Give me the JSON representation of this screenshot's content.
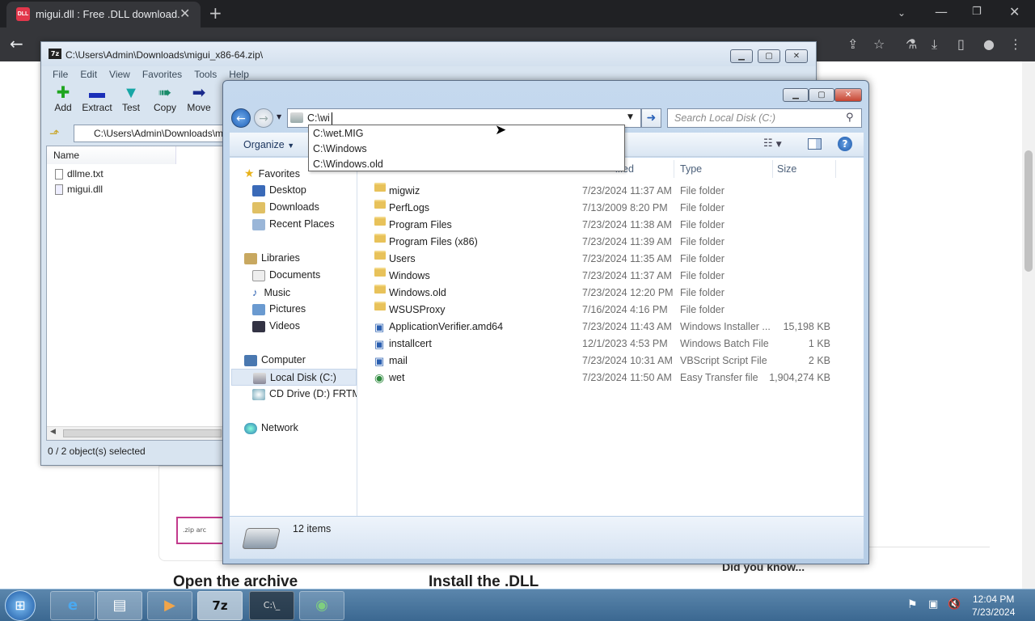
{
  "browser": {
    "tab_title": "migui.dll : Free .DLL download.",
    "tab_favicon": "DLL",
    "page_headings": [
      "Open the archive",
      "Install the .DLL"
    ],
    "page_note": "Did you know...",
    "page_zip_label": ".zip arc"
  },
  "zip_window": {
    "title": "C:\\Users\\Admin\\Downloads\\migui_x86-64.zip\\",
    "menu": [
      "File",
      "Edit",
      "View",
      "Favorites",
      "Tools",
      "Help"
    ],
    "toolbar": [
      {
        "label": "Add",
        "icon": "plus-icon",
        "color": "#1fa51f"
      },
      {
        "label": "Extract",
        "icon": "minus-icon",
        "color": "#1a2fb8"
      },
      {
        "label": "Test",
        "icon": "check-icon",
        "color": "#17a6a6"
      },
      {
        "label": "Copy",
        "icon": "copy-arrow-icon",
        "color": "#1a8c6a"
      },
      {
        "label": "Move",
        "icon": "move-arrow-icon",
        "color": "#1a2a8c"
      }
    ],
    "address": "C:\\Users\\Admin\\Downloads\\m",
    "column_name": "Name",
    "files": [
      "dllme.txt",
      "migui.dll"
    ],
    "status": "0 / 2 object(s) selected"
  },
  "explorer": {
    "address_value": "C:\\wi",
    "search_placeholder": "Search Local Disk (C:)",
    "autocomplete": [
      "C:\\wet.MIG",
      "C:\\Windows",
      "C:\\Windows.old"
    ],
    "organize": "Organize",
    "columns": {
      "modified": "ified",
      "type": "Type",
      "size": "Size"
    },
    "nav": {
      "favorites": "Favorites",
      "favorites_items": [
        "Desktop",
        "Downloads",
        "Recent Places"
      ],
      "libraries": "Libraries",
      "libraries_items": [
        "Documents",
        "Music",
        "Pictures",
        "Videos"
      ],
      "computer": "Computer",
      "computer_items": [
        "Local Disk (C:)",
        "CD Drive (D:) FRTME"
      ],
      "network": "Network"
    },
    "files": [
      {
        "name": "migwiz",
        "date": "7/23/2024 11:37 AM",
        "type": "File folder",
        "size": "",
        "kind": "folder"
      },
      {
        "name": "PerfLogs",
        "date": "7/13/2009 8:20 PM",
        "type": "File folder",
        "size": "",
        "kind": "folder"
      },
      {
        "name": "Program Files",
        "date": "7/23/2024 11:38 AM",
        "type": "File folder",
        "size": "",
        "kind": "folder"
      },
      {
        "name": "Program Files (x86)",
        "date": "7/23/2024 11:39 AM",
        "type": "File folder",
        "size": "",
        "kind": "folder"
      },
      {
        "name": "Users",
        "date": "7/23/2024 11:35 AM",
        "type": "File folder",
        "size": "",
        "kind": "folder"
      },
      {
        "name": "Windows",
        "date": "7/23/2024 11:37 AM",
        "type": "File folder",
        "size": "",
        "kind": "folder"
      },
      {
        "name": "Windows.old",
        "date": "7/23/2024 12:20 PM",
        "type": "File folder",
        "size": "",
        "kind": "folder"
      },
      {
        "name": "WSUSProxy",
        "date": "7/16/2024 4:16 PM",
        "type": "File folder",
        "size": "",
        "kind": "folder"
      },
      {
        "name": "ApplicationVerifier.amd64",
        "date": "7/23/2024 11:43 AM",
        "type": "Windows Installer ...",
        "size": "15,198 KB",
        "kind": "msi"
      },
      {
        "name": "installcert",
        "date": "12/1/2023 4:53 PM",
        "type": "Windows Batch File",
        "size": "1 KB",
        "kind": "bat"
      },
      {
        "name": "mail",
        "date": "7/23/2024 10:31 AM",
        "type": "VBScript Script File",
        "size": "2 KB",
        "kind": "vbs"
      },
      {
        "name": "wet",
        "date": "7/23/2024 11:50 AM",
        "type": "Easy Transfer file",
        "size": "1,904,274 KB",
        "kind": "mig"
      }
    ],
    "item_count": "12 items"
  },
  "taskbar": {
    "time": "12:04 PM",
    "date": "7/23/2024",
    "apps": [
      "ie-icon",
      "folder-icon",
      "media-icon",
      "7zip-icon",
      "cmd-icon",
      "migwiz-icon"
    ]
  }
}
